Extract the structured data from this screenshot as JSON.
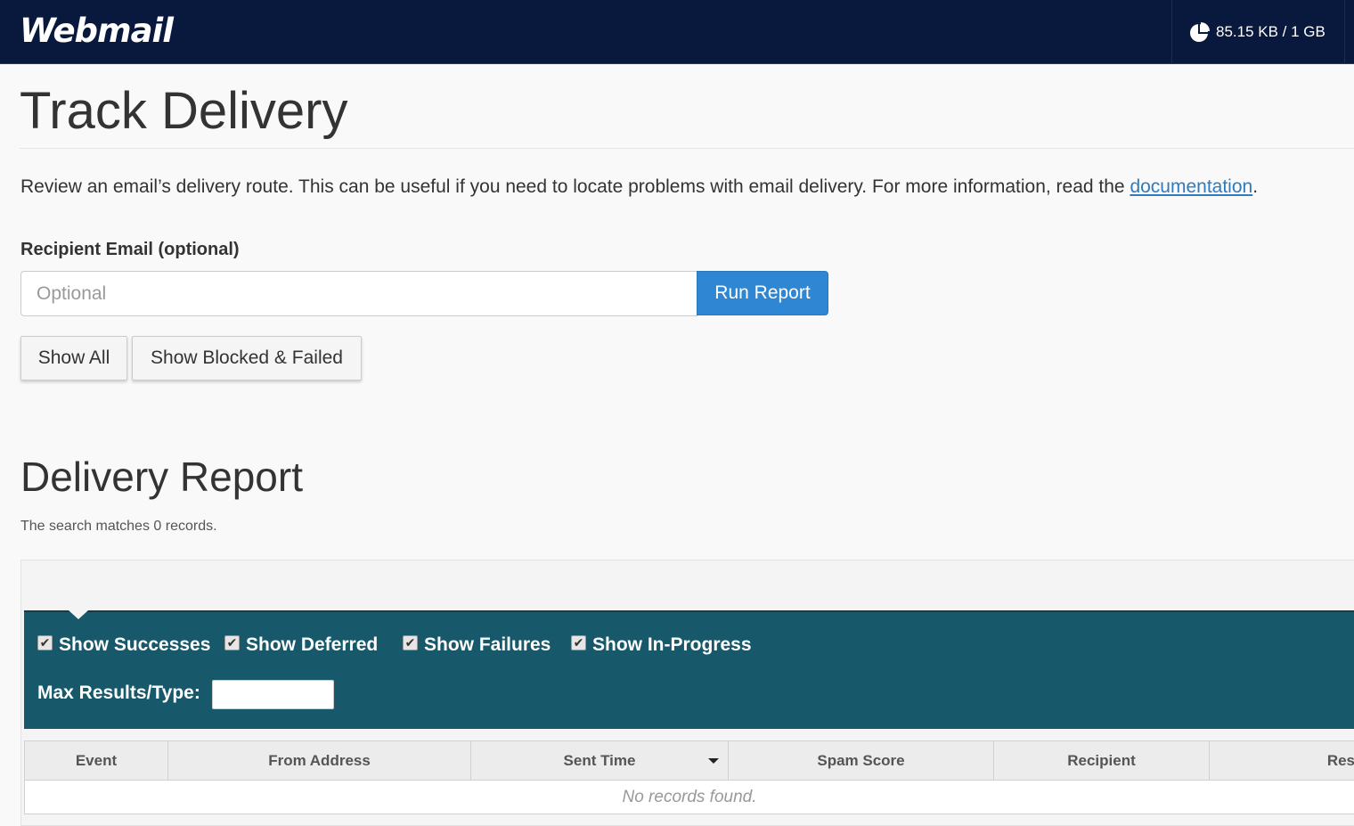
{
  "header": {
    "logo": "Webmail",
    "quota": "85.15 KB / 1 GB",
    "quota_icon": "pie-chart-icon"
  },
  "page": {
    "title": "Track Delivery",
    "intro_text": "Review an email’s delivery route. This can be useful if you need to locate problems with email delivery. For more information, read the ",
    "doc_link": "documentation",
    "intro_end": "."
  },
  "form": {
    "label": "Recipient Email (optional)",
    "placeholder": "Optional",
    "run_button": "Run Report",
    "show_all": "Show All",
    "show_blocked": "Show Blocked & Failed"
  },
  "report": {
    "title": "Delivery Report",
    "match_text": "The search matches 0 records.",
    "filters": [
      {
        "label": "Show Successes",
        "checked": true
      },
      {
        "label": "Show Deferred",
        "checked": true
      },
      {
        "label": "Show Failures",
        "checked": true
      },
      {
        "label": "Show In-Progress",
        "checked": true
      }
    ],
    "max_results_label": "Max Results/Type:",
    "max_results_value": "",
    "columns": [
      "Event",
      "From Address",
      "Sent Time",
      "Spam Score",
      "Recipient",
      "Res"
    ],
    "empty_message": "No records found."
  },
  "colors": {
    "topbar": "#08193d",
    "primary_button": "#2f86d2",
    "filter_panel": "#17596b",
    "link": "#2f7bbf"
  }
}
